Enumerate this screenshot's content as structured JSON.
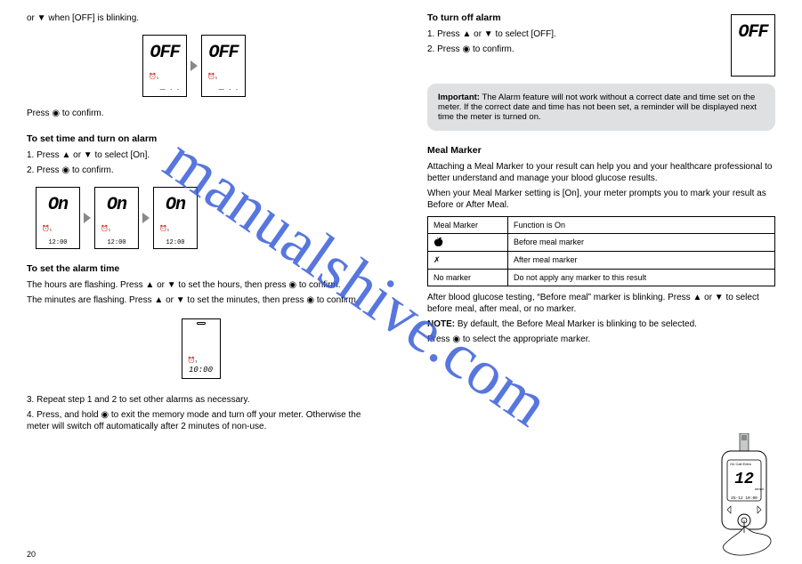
{
  "watermark": "manualshive.com",
  "left": {
    "step1_para": "or ▼ when [OFF] is blinking.",
    "lcd_off": "OFF",
    "dots1": "— - -",
    "dots2": "— - -",
    "step3_confirm": "Press ◉ to confirm.",
    "setTimeOn_heading": "To set time and turn on alarm",
    "setTimeOn_step1": "1. Press ▲ or ▼ to select [On].",
    "setTimeOn_step2": "2. Press ◉ to confirm.",
    "lcd_on": "On",
    "lcd_time": "12:00",
    "setAlarmTime_heading": "To set the alarm time",
    "setAlarmTime_p1": "The hours are flashing. Press ▲ or ▼ to set the hours, then press ◉ to confirm.",
    "setAlarmTime_p2": "The minutes are flashing. Press ▲ or ▼ to set the minutes, then press ◉ to confirm.",
    "tall_lcd_time": "10:00",
    "setAlarmTime_step3": "3. Repeat step 1 and 2 to set other alarms as necessary.",
    "setAlarmTime_step4": "4. Press, and hold ◉ to exit the memory mode and turn off your meter. Otherwise the meter will switch off automatically after 2 minutes of non-use.",
    "page_no": "20"
  },
  "right": {
    "turnOffAlarm_heading": "To turn off alarm",
    "turnOffAlarm_step1": "1. Press ▲ or ▼ to select [OFF].",
    "turnOffAlarm_step2": "2. Press ◉ to confirm.",
    "lcd_off": "OFF",
    "callout_heading": "Important:",
    "callout_body": "The Alarm feature will not work without a correct date and time set on the meter. If the correct date and time has not been set, a reminder will be displayed next time the meter is turned on.",
    "mealMarker_heading": "Meal Marker",
    "mealMarker_p1": "Attaching a Meal Marker to your result can help you and your healthcare professional to better understand and manage your blood glucose results.",
    "mealMarker_p2": "When your Meal Marker setting is [On], your meter prompts you to mark your result as Before or After Meal.",
    "table": {
      "r1": {
        "c1": "Meal Marker",
        "c2": "Function is On"
      },
      "r2": {
        "c1": "apple-icon",
        "c2": "Before meal marker"
      },
      "r3": {
        "c1": "core-icon",
        "c2": "After meal marker"
      },
      "r4": {
        "c1": "No marker",
        "c2": "Do not apply any marker to this result"
      }
    },
    "p3": "After blood glucose testing, “Before meal” marker is blinking. Press ▲ or ▼ to select before meal, after meal, or no marker.",
    "note_heading": "NOTE:",
    "note_body": "By default, the Before Meal Marker is blinking to be selected.",
    "p4": "Press ◉ to select the appropriate marker.",
    "meter_reading": "12",
    "meter_date": "25-12 10:00"
  }
}
